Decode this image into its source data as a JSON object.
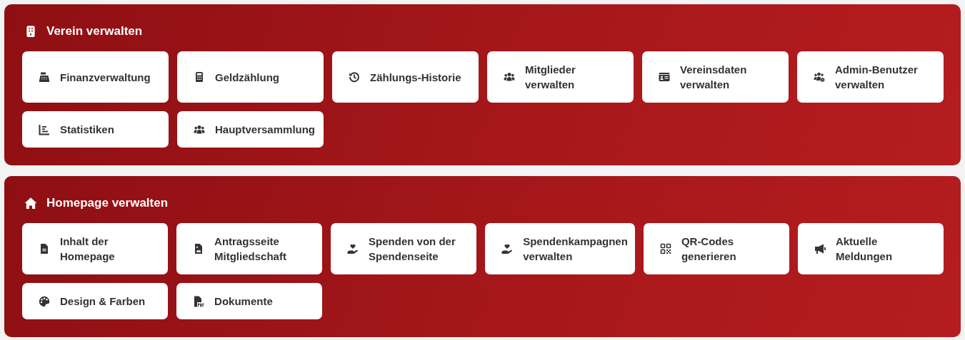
{
  "sections": [
    {
      "title": "Verein verwalten",
      "items": [
        {
          "label": "Finanzverwaltung"
        },
        {
          "label": "Geldzählung"
        },
        {
          "label": "Zählungs-Historie"
        },
        {
          "label": "Mitglieder\nverwalten"
        },
        {
          "label": "Vereinsdaten\nverwalten"
        },
        {
          "label": "Admin-Benutzer\nverwalten"
        },
        {
          "label": "Statistiken"
        },
        {
          "label": "Hauptversammlung"
        }
      ]
    },
    {
      "title": "Homepage verwalten",
      "items": [
        {
          "label": "Inhalt der\nHomepage"
        },
        {
          "label": "Antragsseite\nMitgliedschaft"
        },
        {
          "label": "Spenden von der\nSpendenseite"
        },
        {
          "label": "Spendenkampagnen\nverwalten"
        },
        {
          "label": "QR-Codes\ngenerieren"
        },
        {
          "label": "Aktuelle\nMeldungen"
        },
        {
          "label": "Design & Farben"
        },
        {
          "label": "Dokumente"
        }
      ]
    }
  ]
}
